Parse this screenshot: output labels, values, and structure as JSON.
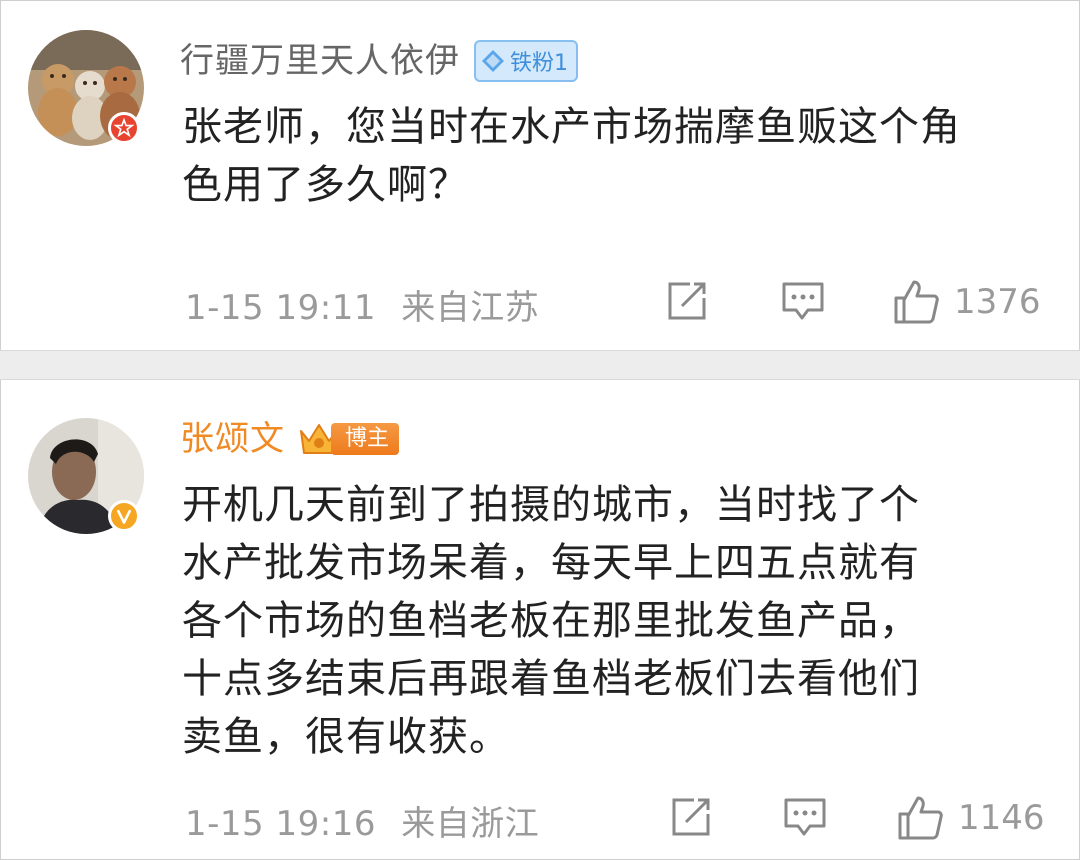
{
  "comments": [
    {
      "username": "行疆万里天人依伊",
      "fan_badge_label": "铁粉1",
      "avatar_badge_icon": "star-icon",
      "text": "张老师，您当时在水产市场揣摩鱼贩这个角\n色用了多久啊？",
      "timestamp": "1-15 19:11",
      "source": "来自江苏",
      "likes": "1376"
    },
    {
      "username": "张颂文",
      "blogger_badge_label": "博主",
      "avatar_badge_icon": "verified-v-icon",
      "text": "开机几天前到了拍摄的城市，当时找了个\n水产批发市场呆着，每天早上四五点就有\n各个市场的鱼档老板在那里批发鱼产品，\n十点多结束后再跟着鱼档老板们去看他们\n卖鱼，很有收获。",
      "timestamp": "1-15 19:16",
      "source": "来自浙江",
      "likes": "1146"
    }
  ],
  "colors": {
    "username_default": "#666666",
    "username_blogger": "#f08a24",
    "meta_gray": "#9a9a9a",
    "fan_badge_bg": "#d4e9fb",
    "separator": "#ededed"
  },
  "icons": [
    "repost-icon",
    "reply-icon",
    "like-icon",
    "diamond-icon",
    "crown-icon"
  ]
}
